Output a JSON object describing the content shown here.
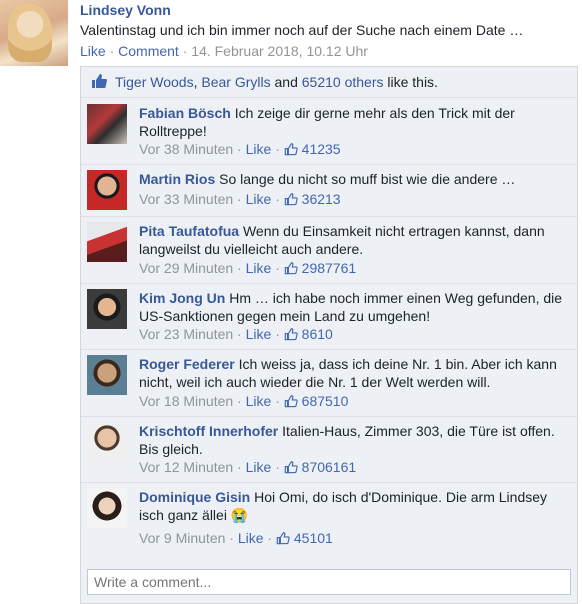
{
  "post": {
    "author": "Lindsey Vonn",
    "text": "Valentinstag und ich bin immer noch auf der Suche nach einem Date …",
    "like": "Like",
    "comment": "Comment",
    "sep": " · ",
    "timestamp": "14. Februar 2018, 10.12 Uhr"
  },
  "likes": {
    "name1": "Tiger Woods",
    "comma": ", ",
    "name2": "Bear Grylls",
    "and": " and ",
    "others": "65210 others",
    "suffix": " like this."
  },
  "comments": [
    {
      "author": "Fabian Bösch",
      "text": "Ich zeige dir gerne mehr als den Trick mit der Rolltreppe!",
      "time": "Vor 38 Minuten",
      "like": "Like",
      "count": "41235"
    },
    {
      "author": "Martin Rios",
      "text": "So lange du nicht so muff bist wie die andere …",
      "time": "Vor 33 Minuten",
      "like": "Like",
      "count": "36213"
    },
    {
      "author": "Pita Taufatofua",
      "text": "Wenn du Einsamkeit nicht ertragen kannst, dann langweilst du vielleicht auch andere.",
      "time": "Vor 29 Minuten",
      "like": "Like",
      "count": "2987761"
    },
    {
      "author": "Kim Jong Un",
      "text": "Hm … ich habe noch immer einen Weg gefunden, die US-Sanktionen gegen mein Land zu umgehen!",
      "time": "Vor 23 Minuten",
      "like": "Like",
      "count": "8610"
    },
    {
      "author": "Roger Federer",
      "text": "Ich weiss ja, dass ich deine Nr. 1 bin. Aber ich kann nicht, weil ich auch wieder die Nr. 1 der Welt werden will.",
      "time": "Vor 18 Minuten",
      "like": "Like",
      "count": "687510"
    },
    {
      "author": "Krischtoff Innerhofer",
      "text": "Italien-Haus, Zimmer 303, die Türe ist offen. Bis gleich.",
      "time": "Vor 12 Minuten",
      "like": "Like",
      "count": "8706161"
    },
    {
      "author": "Dominique Gisin",
      "text": "Hoi Omi, do isch d'Dominique. Die arm Lindsey isch ganz ällei 😭",
      "time": "Vor 9 Minuten",
      "like": "Like",
      "count": "45101"
    }
  ],
  "composer": {
    "placeholder": "Write a comment..."
  },
  "colors": {
    "link": "#385898",
    "meta": "#90949c",
    "panel": "#edf0f5"
  }
}
